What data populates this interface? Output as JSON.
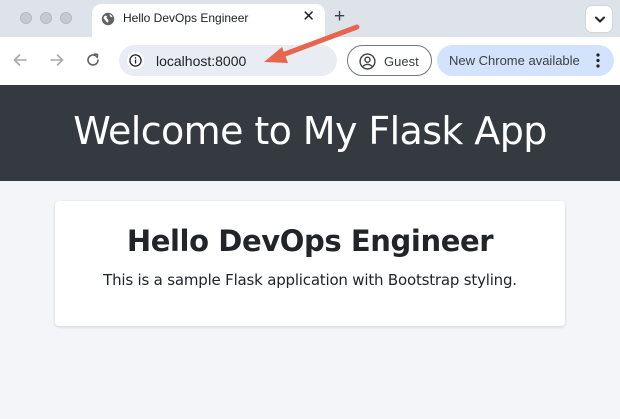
{
  "browser": {
    "tab": {
      "title": "Hello DevOps Engineer",
      "favicon": "globe-icon"
    },
    "omnibox": {
      "url": "localhost:8000"
    },
    "profile": {
      "label": "Guest"
    },
    "update": {
      "label": "New Chrome available"
    },
    "colors": {
      "tabstrip": "#dee3ea",
      "omnibox": "#e9edf3",
      "update_chip": "#d3e3fd",
      "arrow": "#e6664f"
    }
  },
  "page": {
    "hero": {
      "title": "Welcome to My Flask App",
      "background": "#343a40"
    },
    "card": {
      "title": "Hello DevOps Engineer",
      "text": "This is a sample Flask application with Bootstrap styling."
    },
    "background": "#f4f5f8"
  }
}
